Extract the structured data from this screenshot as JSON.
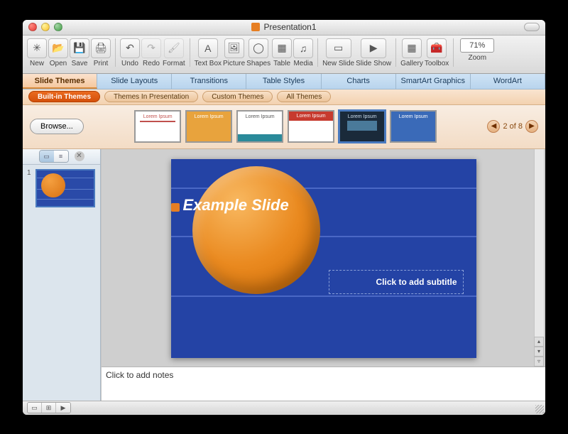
{
  "window": {
    "title": "Presentation1"
  },
  "toolbar": {
    "new": "New",
    "open": "Open",
    "save": "Save",
    "print": "Print",
    "undo": "Undo",
    "redo": "Redo",
    "format": "Format",
    "textbox": "Text Box",
    "picture": "Picture",
    "shapes": "Shapes",
    "table": "Table",
    "media": "Media",
    "newslide": "New Slide",
    "slideshow": "Slide Show",
    "gallery": "Gallery",
    "toolbox": "Toolbox",
    "zoom_value": "71%",
    "zoom_label": "Zoom"
  },
  "ribbon": {
    "tabs": [
      "Slide Themes",
      "Slide Layouts",
      "Transitions",
      "Table Styles",
      "Charts",
      "SmartArt Graphics",
      "WordArt"
    ],
    "active": 0
  },
  "subtabs": {
    "items": [
      "Built-in Themes",
      "Themes In Presentation",
      "Custom Themes",
      "All Themes"
    ],
    "active": 0
  },
  "gallery": {
    "browse": "Browse...",
    "thumbs": [
      {
        "label": "Lorem Ipsum",
        "bg": "#ffffff",
        "accent": "#c0504d"
      },
      {
        "label": "Lorem Ipsum",
        "bg": "#e8a33d",
        "accent": "#ffffff"
      },
      {
        "label": "Lorem Ipsum",
        "bg": "#ffffff",
        "accent": "#2a8a9a"
      },
      {
        "label": "Lorem Ipsum",
        "bg": "#c73a2e",
        "accent": "#ffffff"
      },
      {
        "label": "Lorem Ipsum",
        "bg": "#1a2a3a",
        "accent": "#9ac8e8"
      },
      {
        "label": "Lorem Ipsum",
        "bg": "#3a6ab8",
        "accent": "#ffffff"
      }
    ],
    "pager": "2 of 8"
  },
  "sidebar": {
    "slide_number": "1"
  },
  "slide": {
    "title": "Example Slide",
    "subtitle": "Click to add subtitle"
  },
  "notes": {
    "placeholder": "Click to add notes"
  }
}
